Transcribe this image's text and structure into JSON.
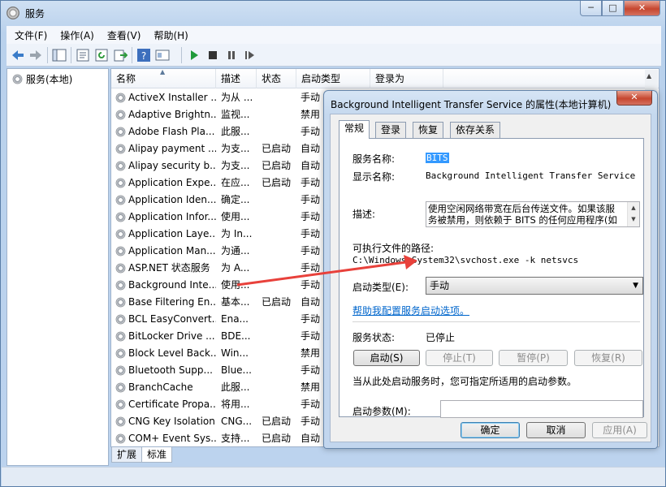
{
  "window": {
    "title": "服务",
    "minimize": "─",
    "maximize": "□",
    "close": "✕"
  },
  "menu": [
    "文件(F)",
    "操作(A)",
    "查看(V)",
    "帮助(H)"
  ],
  "toolbar": [
    "back-icon",
    "forward-icon",
    "show-tree-icon",
    "properties-icon",
    "refresh-icon",
    "export-icon",
    "help-icon",
    "view-icon",
    "play-icon",
    "stop-icon",
    "pause-icon",
    "restart-icon"
  ],
  "tree": {
    "root": "服务(本地)"
  },
  "list": {
    "columns": [
      "名称",
      "描述",
      "状态",
      "启动类型",
      "登录为"
    ],
    "rows": [
      {
        "name": "ActiveX Installer ...",
        "desc": "为从 ...",
        "status": "",
        "startup": "手动"
      },
      {
        "name": "Adaptive Brightn...",
        "desc": "监视...",
        "status": "",
        "startup": "禁用"
      },
      {
        "name": "Adobe Flash Pla...",
        "desc": "此服...",
        "status": "",
        "startup": "手动"
      },
      {
        "name": "Alipay payment ...",
        "desc": "为支...",
        "status": "已启动",
        "startup": "自动"
      },
      {
        "name": "Alipay security b...",
        "desc": "为支...",
        "status": "已启动",
        "startup": "自动"
      },
      {
        "name": "Application Expe...",
        "desc": "在应...",
        "status": "已启动",
        "startup": "手动"
      },
      {
        "name": "Application Iden...",
        "desc": "确定...",
        "status": "",
        "startup": "手动"
      },
      {
        "name": "Application Infor...",
        "desc": "使用...",
        "status": "",
        "startup": "手动"
      },
      {
        "name": "Application Laye...",
        "desc": "为 In...",
        "status": "",
        "startup": "手动"
      },
      {
        "name": "Application Man...",
        "desc": "为通...",
        "status": "",
        "startup": "手动"
      },
      {
        "name": "ASP.NET 状态服务",
        "desc": "为 A...",
        "status": "",
        "startup": "手动"
      },
      {
        "name": "Background Inte...",
        "desc": "使用...",
        "status": "",
        "startup": "手动"
      },
      {
        "name": "Base Filtering En...",
        "desc": "基本...",
        "status": "已启动",
        "startup": "自动"
      },
      {
        "name": "BCL EasyConvert...",
        "desc": "Ena...",
        "status": "",
        "startup": "手动"
      },
      {
        "name": "BitLocker Drive ...",
        "desc": "BDE...",
        "status": "",
        "startup": "手动"
      },
      {
        "name": "Block Level Back...",
        "desc": "Win...",
        "status": "",
        "startup": "禁用"
      },
      {
        "name": "Bluetooth Supp...",
        "desc": "Blue...",
        "status": "",
        "startup": "手动"
      },
      {
        "name": "BranchCache",
        "desc": "此服...",
        "status": "",
        "startup": "禁用"
      },
      {
        "name": "Certificate Propa...",
        "desc": "将用...",
        "status": "",
        "startup": "手动"
      },
      {
        "name": "CNG Key Isolation",
        "desc": "CNG...",
        "status": "已启动",
        "startup": "手动"
      },
      {
        "name": "COM+ Event Sys...",
        "desc": "支持...",
        "status": "已启动",
        "startup": "自动"
      }
    ],
    "tabs": [
      "扩展",
      "标准"
    ]
  },
  "dialog": {
    "title": "Background Intelligent Transfer Service 的属性(本地计算机)",
    "close": "✕",
    "tabs": [
      "常规",
      "登录",
      "恢复",
      "依存关系"
    ],
    "service_name_label": "服务名称:",
    "service_name": "BITS",
    "display_name_label": "显示名称:",
    "display_name": "Background Intelligent Transfer Service",
    "desc_label": "描述:",
    "desc_line1": "使用空闲网络带宽在后台传送文件。如果该服",
    "desc_line2": "务被禁用，则依赖于 BITS 的任何应用程序(如",
    "path_label": "可执行文件的路径:",
    "path": "C:\\Windows\\System32\\svchost.exe -k netsvcs",
    "startup_label": "启动类型(E):",
    "startup_value": "手动",
    "help_link": "帮助我配置服务启动选项。",
    "status_label": "服务状态:",
    "status_value": "已停止",
    "buttons": {
      "start": "启动(S)",
      "stop": "停止(T)",
      "pause": "暂停(P)",
      "resume": "恢复(R)"
    },
    "hint": "当从此处启动服务时，您可指定所适用的启动参数。",
    "param_label": "启动参数(M):",
    "ok": "确定",
    "cancel": "取消",
    "apply": "应用(A)"
  },
  "colors": {
    "annotation_arrow": "#e8413b",
    "link": "#0066cc",
    "selection": "#3399ff"
  }
}
